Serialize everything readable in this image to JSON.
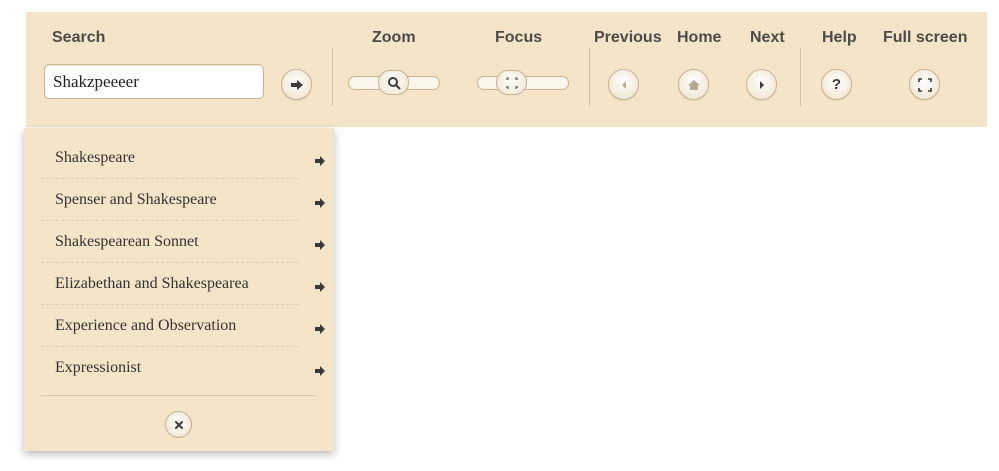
{
  "toolbar": {
    "search_label": "Search",
    "zoom_label": "Zoom",
    "focus_label": "Focus",
    "previous_label": "Previous",
    "home_label": "Home",
    "next_label": "Next",
    "help_label": "Help",
    "fullscreen_label": "Full screen",
    "search_value": "Shakzpeeeer",
    "help_glyph": "?"
  },
  "icons": {
    "search_go": "arrow-right-icon",
    "zoom_knob": "magnifier-icon",
    "focus_knob": "focus-icon",
    "previous": "chevron-left-icon",
    "home": "home-icon",
    "next": "chevron-right-icon",
    "help": "question-icon",
    "fullscreen": "expand-icon",
    "suggestion_arrow": "arrow-right-icon",
    "close": "close-icon"
  },
  "suggestions": {
    "items": [
      {
        "label": "Shakespeare"
      },
      {
        "label": "Spenser and Shakespeare"
      },
      {
        "label": "Shakespearean Sonnet"
      },
      {
        "label": "Elizabethan and Shakespearea"
      },
      {
        "label": "Experience and Observation"
      },
      {
        "label": "Expressionist"
      }
    ]
  },
  "colors": {
    "panel_bg": "#f4e5c9",
    "text_dark": "#4d4b4a",
    "icon_dark": "#3b3a39",
    "icon_muted": "#b8a98f"
  }
}
